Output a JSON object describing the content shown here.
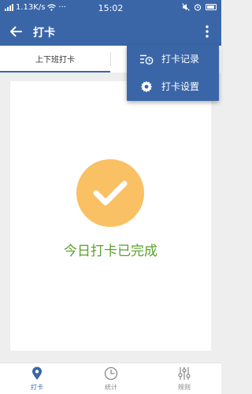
{
  "status_bar": {
    "speed": "1.13K/s",
    "dots": "···",
    "time": "15:02"
  },
  "app_bar": {
    "title": "打卡"
  },
  "tabs": [
    {
      "label": "上下班打卡",
      "active": true
    }
  ],
  "card": {
    "status_text": "今日打卡已完成"
  },
  "menu": {
    "items": [
      {
        "label": "打卡记录",
        "icon": "list-clock-icon"
      },
      {
        "label": "打卡设置",
        "icon": "gear-icon"
      }
    ]
  },
  "bottom_nav": {
    "items": [
      {
        "label": "打卡",
        "icon": "location-pin-icon",
        "active": true
      },
      {
        "label": "统计",
        "icon": "clock-chart-icon",
        "active": false
      },
      {
        "label": "规则",
        "icon": "sliders-icon",
        "active": false
      }
    ]
  },
  "colors": {
    "primary": "#3a66a8",
    "success_circle": "#f9c064",
    "success_text": "#5aa02c"
  }
}
